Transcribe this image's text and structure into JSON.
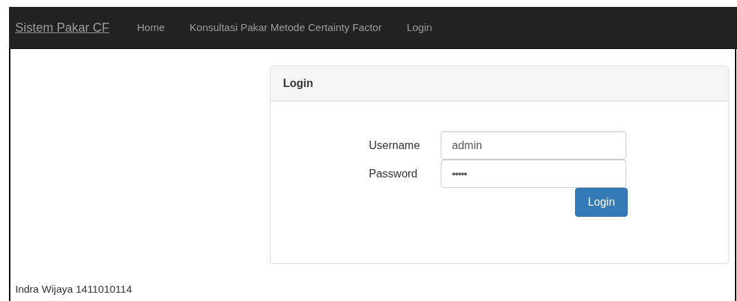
{
  "navbar": {
    "brand": "Sistem Pakar CF",
    "links": [
      {
        "label": "Home"
      },
      {
        "label": "Konsultasi Pakar Metode Certainty Factor"
      },
      {
        "label": "Login"
      }
    ]
  },
  "login_panel": {
    "title": "Login",
    "fields": [
      {
        "label": "Username",
        "kind": "text",
        "value": "admin"
      },
      {
        "label": "Password",
        "kind": "password",
        "value": "•••••"
      }
    ],
    "button": "Login"
  },
  "footer": "Indra Wijaya 1411010114"
}
